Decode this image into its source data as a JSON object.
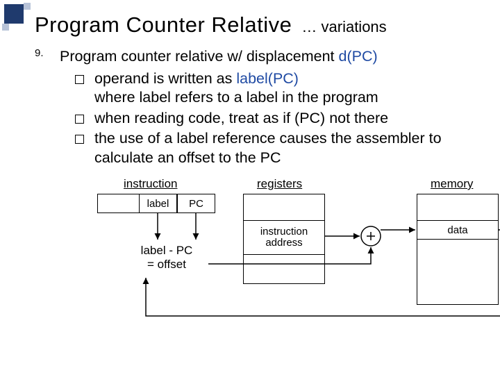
{
  "header": {
    "title": "Program Counter Relative",
    "suffix": "… variations"
  },
  "list_number": "9.",
  "heading_line": {
    "prefix": "Program counter relative w/ displacement  ",
    "blue": "d(PC)"
  },
  "bullets": [
    {
      "line1_prefix": "operand is written as   ",
      "line1_blue": "label(PC)",
      "line2": "where label refers to a label in the program"
    },
    {
      "line": "when reading code, treat as if (PC) not there"
    },
    {
      "line": "the use of a label reference causes the assembler to calculate an offset to the PC"
    }
  ],
  "diagram": {
    "instruction_label": "instruction",
    "registers_label": "registers",
    "memory_label": "memory",
    "cell_label": "label",
    "cell_pc": "PC",
    "offset_text_line1": "label - PC",
    "offset_text_line2": "= offset",
    "instr_addr_line1": "instruction",
    "instr_addr_line2": "address",
    "data_label": "data"
  }
}
